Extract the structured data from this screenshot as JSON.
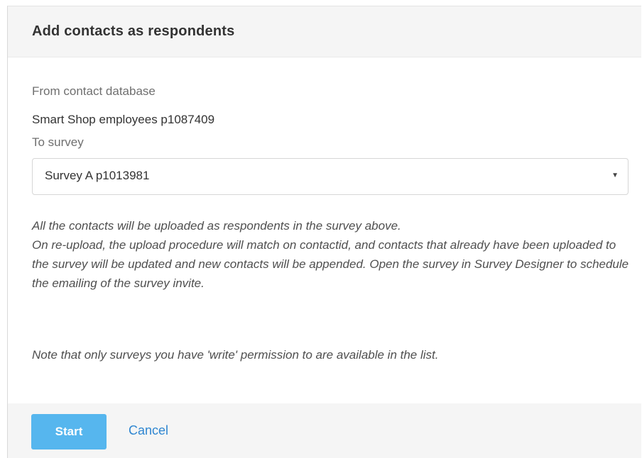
{
  "dialog": {
    "title": "Add contacts as respondents"
  },
  "source": {
    "label": "From contact database",
    "value": "Smart Shop employees p1087409"
  },
  "target": {
    "label": "To survey",
    "selected": "Survey A p1013981"
  },
  "help": {
    "line1": "All the contacts will be uploaded as respondents in the survey above.",
    "line2": "On re-upload, the upload procedure will match on contactid, and contacts that already have been uploaded to the survey will be updated and new contacts will be appended. Open the survey in Survey Designer to schedule the emailing of the survey invite.",
    "note": "Note that only surveys you have 'write' permission to are available in the list."
  },
  "footer": {
    "start_label": "Start",
    "cancel_label": "Cancel"
  },
  "icons": {
    "select_caret": "caret-down-icon"
  },
  "colors": {
    "primary_button": "#56b6ee",
    "link": "#2f86d1"
  }
}
